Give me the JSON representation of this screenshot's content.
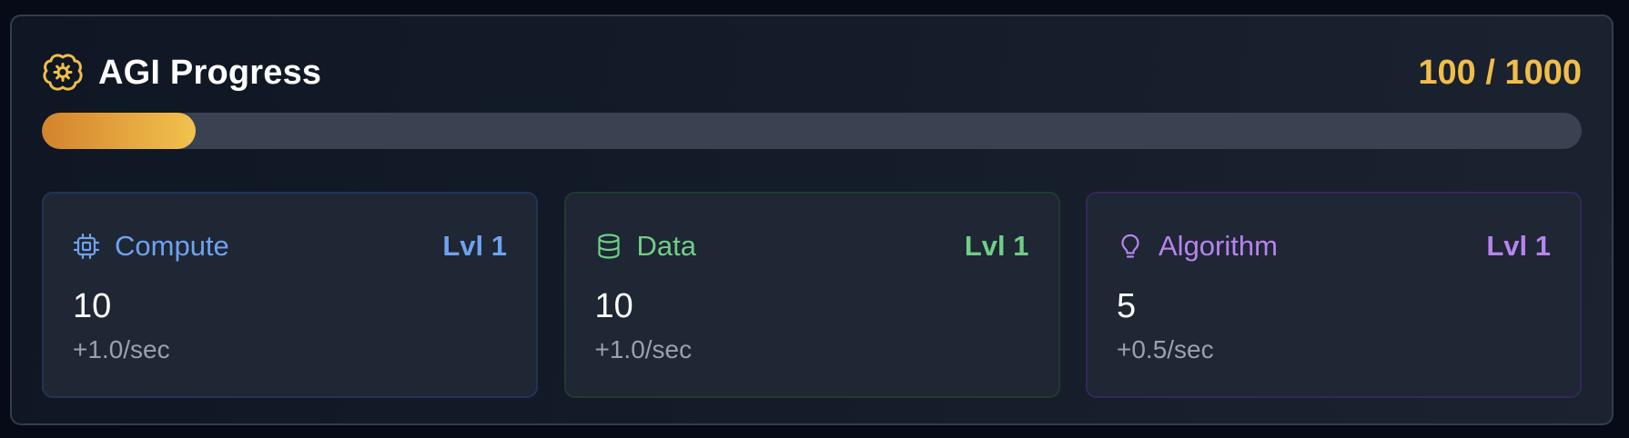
{
  "header": {
    "title": "AGI Progress",
    "progress_text": "100 / 1000",
    "progress_fraction": 0.1,
    "icon": "brain-icon",
    "accent_color": "#f0bd4b"
  },
  "resources": [
    {
      "name": "Compute",
      "level": "Lvl 1",
      "value": "10",
      "rate": "+1.0/sec",
      "icon": "cpu-chip-icon",
      "color": "#6ea2ef"
    },
    {
      "name": "Data",
      "level": "Lvl 1",
      "value": "10",
      "rate": "+1.0/sec",
      "icon": "database-icon",
      "color": "#6fcf86"
    },
    {
      "name": "Algorithm",
      "level": "Lvl 1",
      "value": "5",
      "rate": "+0.5/sec",
      "icon": "lightbulb-icon",
      "color": "#b684ef"
    }
  ]
}
